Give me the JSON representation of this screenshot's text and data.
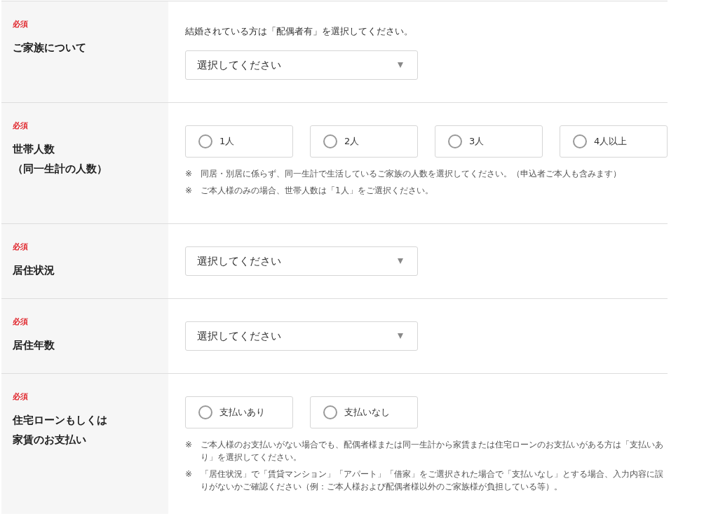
{
  "rows": [
    {
      "required": "必須",
      "label_lines": [
        "ご家族について"
      ],
      "intro": "結婚されている方は「配偶者有」を選択してください。",
      "field": {
        "kind": "select",
        "placeholder": "選択してください"
      }
    },
    {
      "required": "必須",
      "label_lines": [
        "世帯人数",
        "（同一生計の人数）"
      ],
      "field": {
        "kind": "radio",
        "options": [
          {
            "label": "1人",
            "selected": false
          },
          {
            "label": "2人",
            "selected": false
          },
          {
            "label": "3人",
            "selected": false
          },
          {
            "label": "4人以上",
            "selected": false
          }
        ]
      },
      "notes": [
        {
          "mark": "※",
          "text": "同居・別居に係らず、同一生計で生活しているご家族の人数を選択してください。（申込者ご本人も含みます）"
        },
        {
          "mark": "※",
          "text": "ご本人様のみの場合、世帯人数は「1人」をご選択ください。"
        }
      ]
    },
    {
      "required": "必須",
      "label_lines": [
        "居住状況"
      ],
      "field": {
        "kind": "select",
        "placeholder": "選択してください"
      }
    },
    {
      "required": "必須",
      "label_lines": [
        "居住年数"
      ],
      "field": {
        "kind": "select",
        "placeholder": "選択してください"
      }
    },
    {
      "required": "必須",
      "label_lines": [
        "住宅ローンもしくは",
        "家賃のお支払い"
      ],
      "field": {
        "kind": "radio",
        "options": [
          {
            "label": "支払いあり",
            "selected": false
          },
          {
            "label": "支払いなし",
            "selected": false
          }
        ]
      },
      "notes": [
        {
          "mark": "※",
          "text": "ご本人様のお支払いがない場合でも、配偶者様または同一生計から家賃または住宅ローンのお支払いがある方は「支払いあり」を選択してください。"
        },
        {
          "mark": "※",
          "text": "「居住状況」で「賃貸マンション」「アパート」「借家」をご選択された場合で「支払いなし」とする場合、入力内容に誤りがないかご確認ください（例：ご本人様および配偶者様以外のご家族様が負担している等）。"
        }
      ]
    }
  ]
}
